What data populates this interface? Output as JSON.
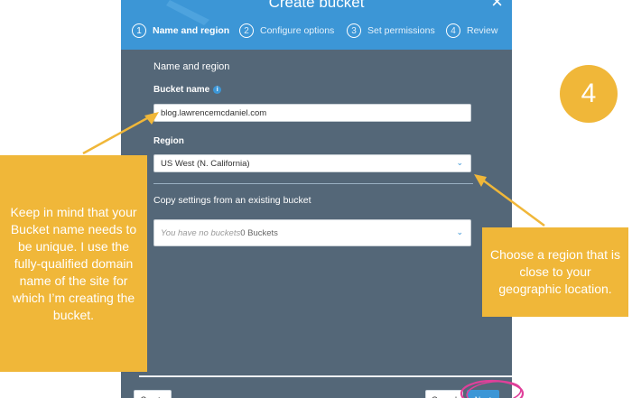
{
  "modal": {
    "title": "Create bucket",
    "steps": [
      {
        "num": "1",
        "label": "Name and region"
      },
      {
        "num": "2",
        "label": "Configure options"
      },
      {
        "num": "3",
        "label": "Set permissions"
      },
      {
        "num": "4",
        "label": "Review"
      }
    ],
    "section_title": "Name and region",
    "bucket_name_label": "Bucket name",
    "bucket_name_value": "blog.lawrencemcdaniel.com",
    "region_label": "Region",
    "region_value": "US West (N. California)",
    "copy_settings_label": "Copy settings from an existing bucket",
    "copy_placeholder_italic": "You have no buckets",
    "copy_placeholder_count": "0 Buckets",
    "buttons": {
      "create": "Create",
      "cancel": "Cancel",
      "next": "Next"
    }
  },
  "callouts": {
    "left": "Keep in mind that your Bucket name needs to be unique. I use the fully-qualified domain name of the site for which I’m creating the bucket.",
    "right": "Choose a region that is close to your geographic location.",
    "badge": "4"
  },
  "colors": {
    "accent": "#3c96d6",
    "callout": "#f0b739",
    "modal_bg": "#546778",
    "highlight": "#e0409a"
  }
}
